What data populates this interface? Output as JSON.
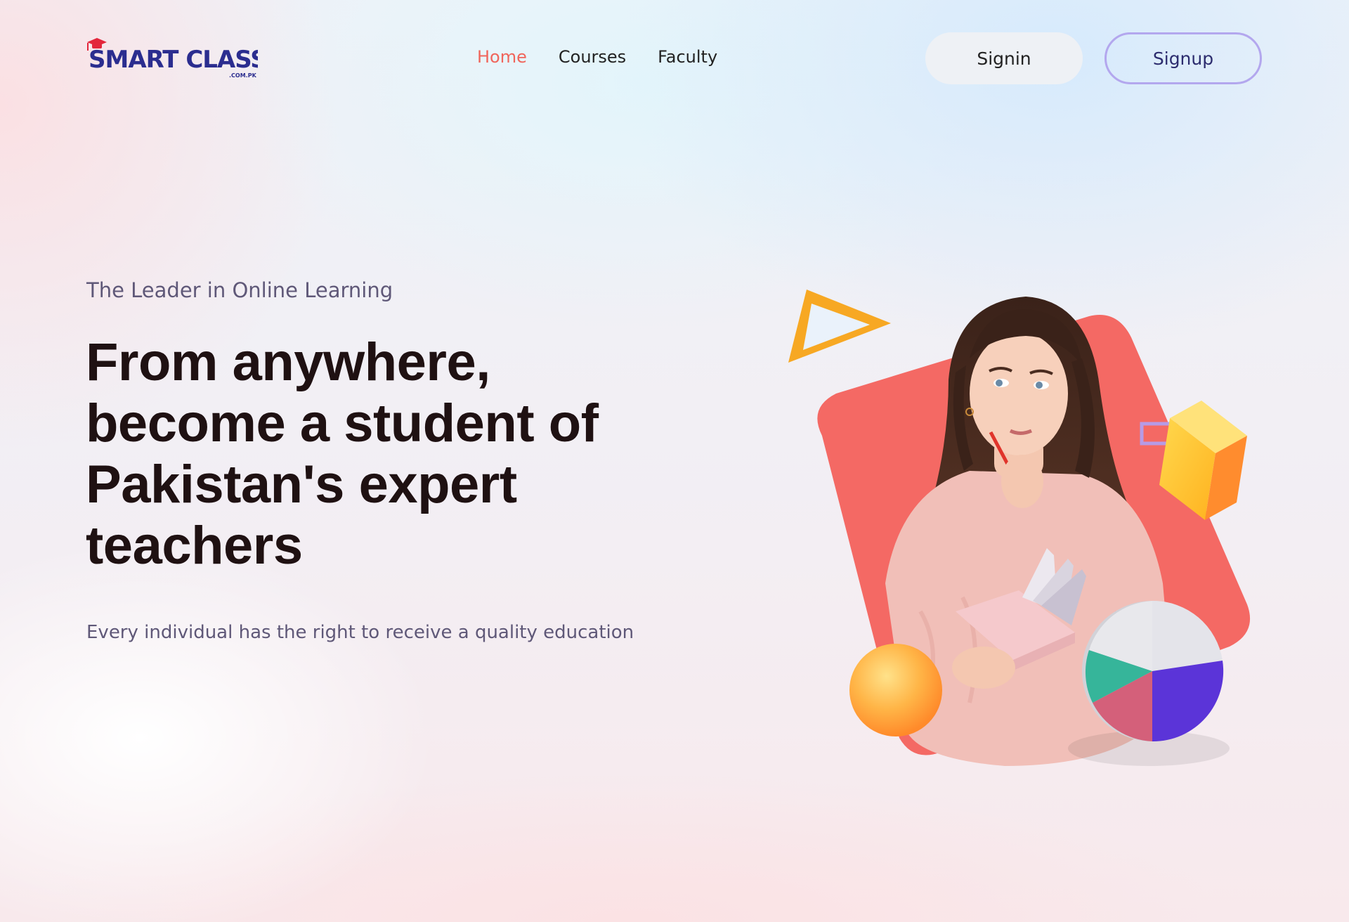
{
  "header": {
    "logo_text": "SMART CLASS",
    "logo_domain": ".COM.PK",
    "nav": [
      {
        "label": "Home",
        "active": true
      },
      {
        "label": "Courses",
        "active": false
      },
      {
        "label": "Faculty",
        "active": false
      }
    ],
    "signin_label": "Signin",
    "signup_label": "Signup"
  },
  "hero": {
    "eyebrow": "The Leader in Online Learning",
    "headline_lines": [
      "From anywhere,",
      "become a student of",
      "Pakistan's expert",
      "teachers"
    ],
    "subtext": "Every individual has the right to receive a quality education"
  },
  "colors": {
    "accent": "#f0655b",
    "headline": "#1f1112",
    "muted": "#5f5878",
    "signup_border": "#b3a7ee",
    "logo_blue": "#2b2d8f",
    "logo_red": "#e3263b"
  },
  "icons": [
    "graduation-cap-icon"
  ]
}
